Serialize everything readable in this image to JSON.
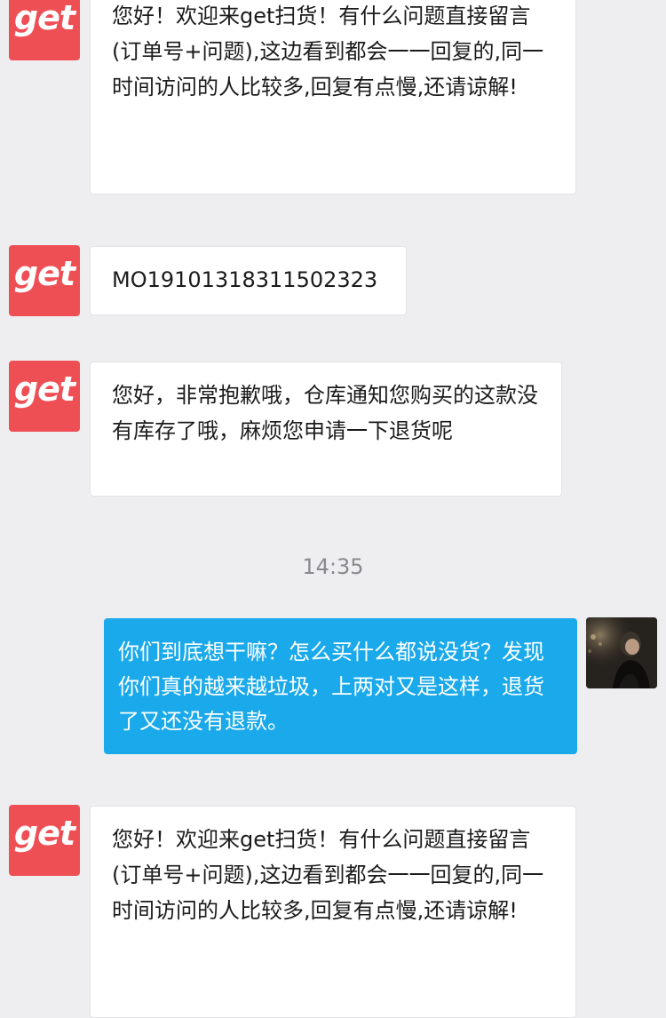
{
  "brand": {
    "logo_text": "get",
    "logo_color": "#ee4f55"
  },
  "colors": {
    "background": "#eeeef0",
    "sent_bubble": "#1aa9ea",
    "received_bubble": "#ffffff"
  },
  "messages": [
    {
      "sender": "get",
      "text": "您好！欢迎来get扫货！有什么问题直接留言(订单号+问题),这边看到都会一一回复的,同一时间访问的人比较多,回复有点慢,还请谅解!"
    },
    {
      "sender": "get",
      "text": "MO19101318311502323"
    },
    {
      "sender": "get",
      "text": "您好，非常抱歉哦，仓库通知您购买的这款没有库存了哦，麻烦您申请一下退货呢"
    },
    {
      "sender": "user",
      "text": "你们到底想干嘛？怎么买什么都说没货？发现你们真的越来越垃圾，上两对又是这样，退货了又还没有退款。"
    },
    {
      "sender": "get",
      "text": "您好！欢迎来get扫货！有什么问题直接留言(订单号+问题),这边看到都会一一回复的,同一时间访问的人比较多,回复有点慢,还请谅解!"
    }
  ],
  "timestamp": "14:35"
}
